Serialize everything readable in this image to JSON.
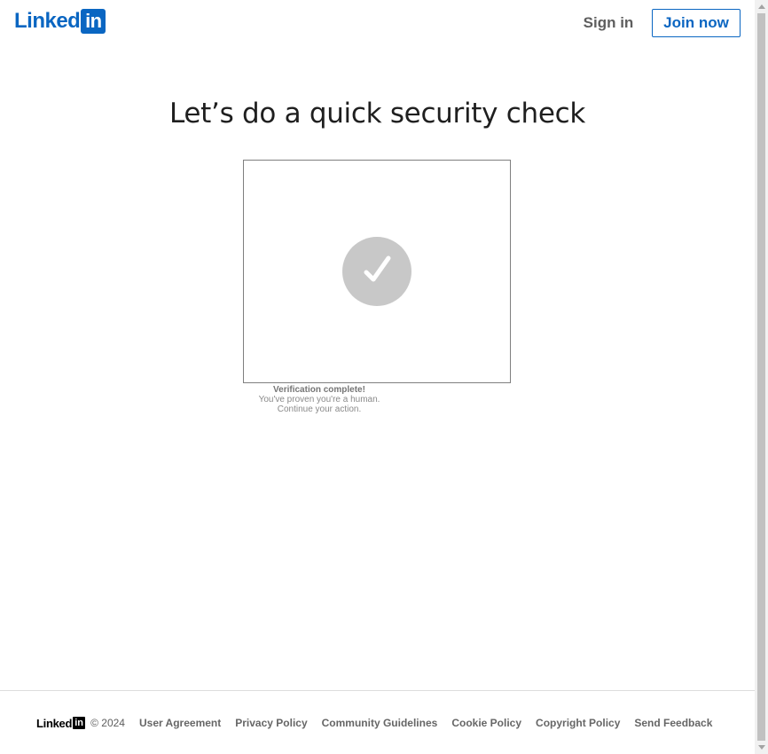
{
  "header": {
    "logo_word": "Linked",
    "logo_box": "in",
    "sign_in_label": "Sign in",
    "join_now_label": "Join now"
  },
  "main": {
    "title": "Let’s do a quick security check",
    "challenge": {
      "status_icon": "checkmark-icon",
      "status_heading": "Verification complete!",
      "status_line1": "You've proven you're a human.",
      "status_line2": "Continue your action."
    }
  },
  "footer": {
    "logo_word": "Linked",
    "logo_box": "in",
    "copyright": "© 2024",
    "links": [
      "User Agreement",
      "Privacy Policy",
      "Community Guidelines",
      "Cookie Policy",
      "Copyright Policy",
      "Send Feedback"
    ]
  },
  "colors": {
    "brand": "#0a66c2",
    "check_circle": "#c8c8c8",
    "text_dark": "#1f1f1f",
    "text_muted": "#5e5e5e"
  }
}
